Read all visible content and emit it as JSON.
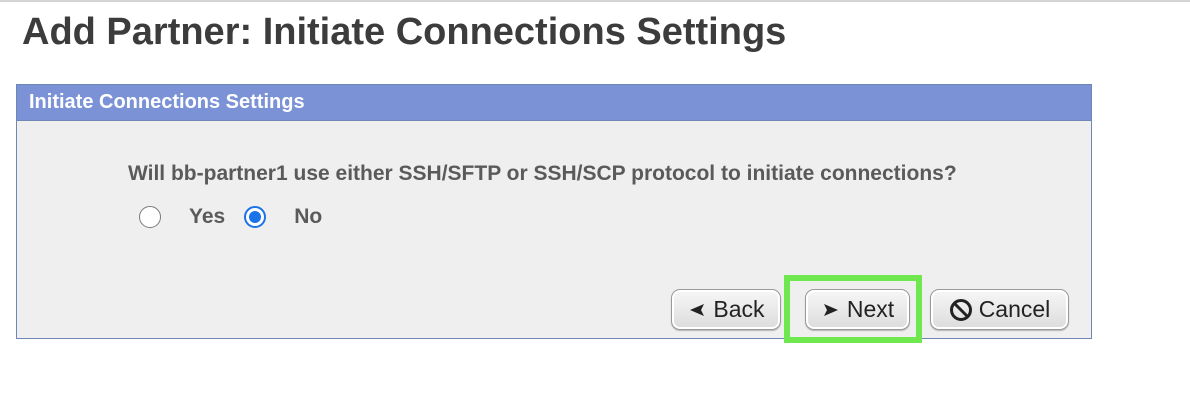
{
  "page": {
    "title": "Add Partner: Initiate Connections Settings"
  },
  "panel": {
    "header": "Initiate Connections Settings",
    "question": "Will bb-partner1 use either SSH/SFTP or SSH/SCP protocol to initiate connections?",
    "options": [
      {
        "label": "Yes",
        "selected": false
      },
      {
        "label": "No",
        "selected": true
      }
    ]
  },
  "buttons": {
    "back": {
      "label": "Back",
      "icon": "chevron-left-icon"
    },
    "next": {
      "label": "Next",
      "icon": "chevron-right-icon"
    },
    "cancel": {
      "label": "Cancel",
      "icon": "prohibit-icon"
    }
  },
  "colors": {
    "header_bg": "#7b93d6",
    "panel_bg": "#efefef",
    "radio_selected": "#1a73e8",
    "highlight": "#6ee84e"
  }
}
